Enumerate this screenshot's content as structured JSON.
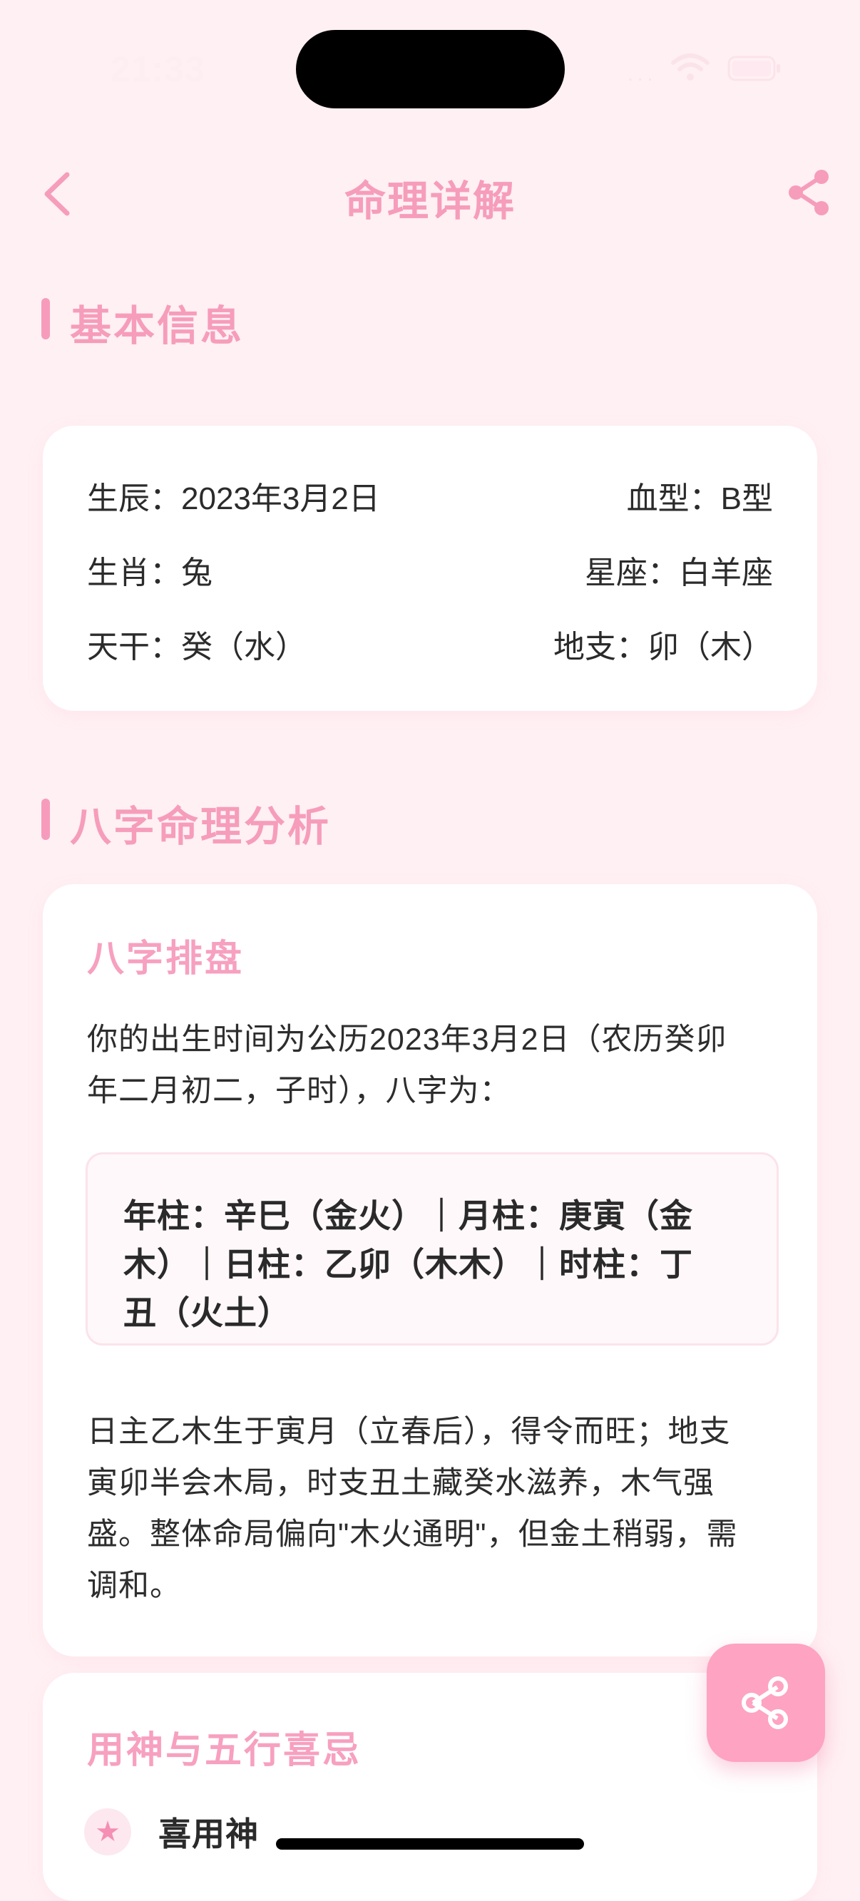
{
  "status_bar": {
    "time": "21:33",
    "signal_dots": "...",
    "wifi_icon": "wifi-icon",
    "battery_icon": "battery-icon"
  },
  "nav": {
    "title": "命理详解",
    "back_icon": "chevron-left-icon",
    "share_icon": "share-icon"
  },
  "basic_info": {
    "heading": "基本信息",
    "rows": [
      {
        "left": "生辰：2023年3月2日",
        "right": "血型：B型"
      },
      {
        "left": "生肖：兔",
        "right": "星座：白羊座"
      },
      {
        "left": "天干：癸（水）",
        "right": "地支：卯（木）"
      }
    ]
  },
  "bazi": {
    "heading": "八字命理分析",
    "card_title": "八字排盘",
    "intro_lines": [
      "你的出生时间为公历2023年3月2日（农历癸卯",
      "年二月初二，子时），八字为："
    ],
    "pillar_lines": [
      "年柱：辛巳（金火）｜月柱：庚寅（金",
      "木）｜日柱：乙卯（木木）｜时柱：丁",
      "丑（火土）"
    ],
    "analysis_lines": [
      "日主乙木生于寅月（立春后），得令而旺；地支",
      "寅卯半会木局，时支丑土藏癸水滋养，木气强",
      "盛。整体命局偏向\"木火通明\"，但金土稍弱，需",
      "调和。"
    ]
  },
  "yongshen": {
    "card_title": "用神与五行喜忌",
    "star_icon": "★",
    "label": "喜用神"
  },
  "fab": {
    "icon": "share-icon"
  },
  "colors": {
    "accent": "#f69dbb",
    "background": "#fff0f3",
    "fab": "#fea3c1"
  }
}
